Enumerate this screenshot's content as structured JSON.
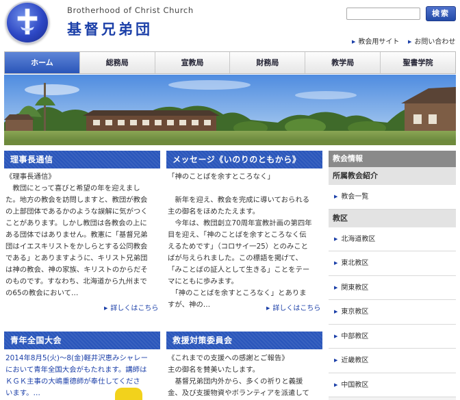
{
  "header": {
    "site_name_en": "Brotherhood of Christ Church",
    "site_name_ja": "基督兄弟団",
    "search_button": "検索",
    "links": [
      "教会用サイト",
      "お問い合わせ"
    ]
  },
  "nav": {
    "items": [
      "ホーム",
      "総務局",
      "宣教局",
      "財務局",
      "教学局",
      "聖書学院"
    ],
    "active_index": 0
  },
  "col1": {
    "title": "理事長通信",
    "lines": [
      "《理事長通信》",
      "　教団にとって喜びと希望の年を迎えまし",
      "た。地方の教会を訪問しますと、教団が教会",
      "の上部団体であるかのような誤解に気がつく",
      "ことがあります。しかし教団は各教会の上に",
      "ある団体ではありません。教憲に「基督兄弟",
      "団はイエスキリストをかしらとする公同教会",
      "である」とありますように、キリスト兄弟団",
      "は神の教会、神の家族、キリストのからだそ",
      "のものです。すなわち、北海道から九州まで",
      "の65の教会において…"
    ],
    "more": "詳しくはこちら"
  },
  "col2": {
    "title": "メッセージ《いのりのともから》",
    "lines": [
      "「神のことばを余すところなく」",
      "",
      "　新年を迎え、教会を完成に導いておられる",
      "主の御名をほめたたえます。",
      "　今年は、教団創立70周年宣教計画の第四年",
      "目を迎え、「神のことばを余すところなく伝",
      "えるためです」（コロサイ一25）とのみこと",
      "ばが与えられました。この標語を掲げて、",
      "「みことばの証人として生きる」ことをテー",
      "マにともに歩みます。",
      "　「神のことばを余すところなく」とありま",
      "すが、神の…"
    ],
    "more": "詳しくはこちら"
  },
  "col3": {
    "title": "青年全国大会",
    "lines": [
      "2014年8月5(火)〜8(金)軽井沢恵みシャレー",
      "において青年全国大会がもたれます。講師は",
      "ＫＧＫ主事の大嶋重德師が奉仕してくださ",
      "います。…"
    ]
  },
  "col4": {
    "title": "救援対策委員会",
    "lines": [
      "《これまでの支援への感謝とご報告》",
      "主の御名を賛美いたします。",
      "　基督兄弟団内外から、多くの祈りと義援",
      "金、及び支援物資やボランティアを派遣して"
    ]
  },
  "sidebar": {
    "title": "教会情報",
    "section1": "所属教会紹介",
    "section1_items": [
      "教会一覧"
    ],
    "section2": "教区",
    "section2_items": [
      "北海道教区",
      "東北教区",
      "関東教区",
      "東京教区",
      "中部教区",
      "近畿教区",
      "中国教区"
    ]
  },
  "colors": {
    "brand_blue": "#2a56bb",
    "title_blue": "#1b3fa8",
    "sidebar_gray": "#8a8a8a"
  }
}
